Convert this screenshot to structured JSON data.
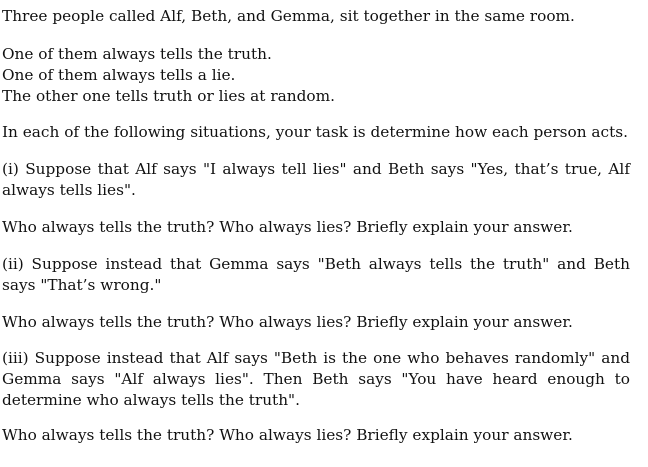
{
  "document": {
    "intro": "Three people called Alf, Beth, and Gemma, sit together in the same room.",
    "rules": [
      "One of them always tells the truth.",
      "One of them always tells a lie.",
      "The other one tells truth or lies at random."
    ],
    "task": "In each of the following situations, your task is determine how each person acts.",
    "part_i": "(i) Suppose that Alf says \"I always tell lies\" and Beth says \"Yes, that’s true, Alf always tells lies\".",
    "question_i": "Who always tells the truth? Who always lies? Briefly explain your answer.",
    "part_ii": "(ii) Suppose instead that Gemma says \"Beth always tells the truth\" and Beth says \"That’s wrong.\"",
    "question_ii": "Who always tells the truth? Who always lies? Briefly explain your answer.",
    "part_iii": "(iii) Suppose instead that Alf says \"Beth is the one who behaves randomly\" and Gemma says \"Alf always lies\". Then Beth says \"You have heard enough to determine who always tells the truth\".",
    "question_iii": "Who always tells the truth? Who always lies? Briefly explain your answer."
  }
}
